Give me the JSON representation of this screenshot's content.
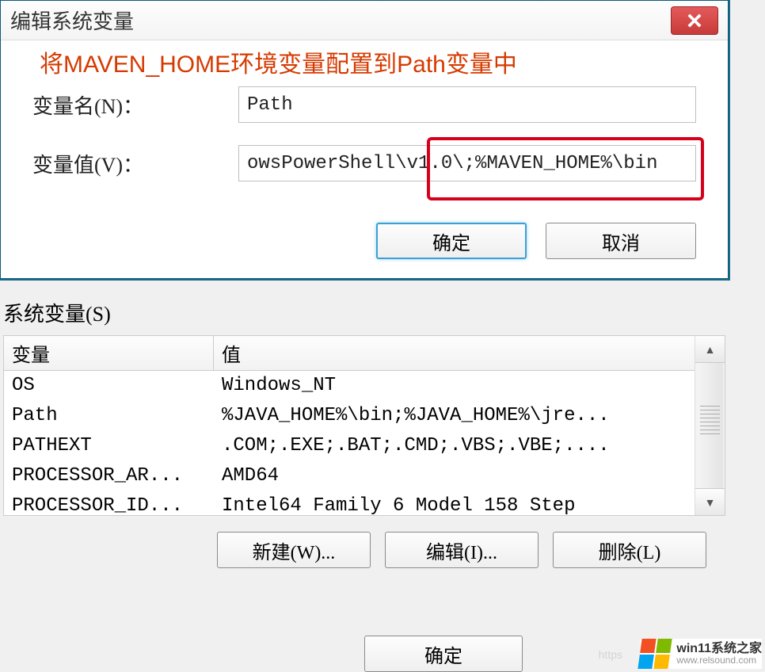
{
  "dialog": {
    "title": "编辑系统变量",
    "annotation": "将MAVEN_HOME环境变量配置到Path变量中",
    "name_label": "变量名(N)：",
    "name_value": "Path",
    "value_label": "变量值(V)：",
    "value_value": "owsPowerShell\\v1.0\\;%MAVEN_HOME%\\bin",
    "ok": "确定",
    "cancel": "取消"
  },
  "sys": {
    "legend": "系统变量(S)",
    "col_var": "变量",
    "col_val": "值",
    "rows": [
      {
        "k": "OS",
        "v": "Windows_NT"
      },
      {
        "k": "Path",
        "v": "%JAVA_HOME%\\bin;%JAVA_HOME%\\jre..."
      },
      {
        "k": "PATHEXT",
        "v": ".COM;.EXE;.BAT;.CMD;.VBS;.VBE;...."
      },
      {
        "k": "PROCESSOR_AR...",
        "v": "AMD64"
      },
      {
        "k": "PROCESSOR_ID...",
        "v": "Intel64 Family 6 Model 158 Step"
      }
    ],
    "new": "新建(W)...",
    "edit": "编辑(I)...",
    "delete": "删除(L)"
  },
  "outer": {
    "ok": "确定"
  },
  "ghost_url": "https",
  "watermark": {
    "line1": "win11系统之家",
    "line2": "www.relsound.com"
  }
}
